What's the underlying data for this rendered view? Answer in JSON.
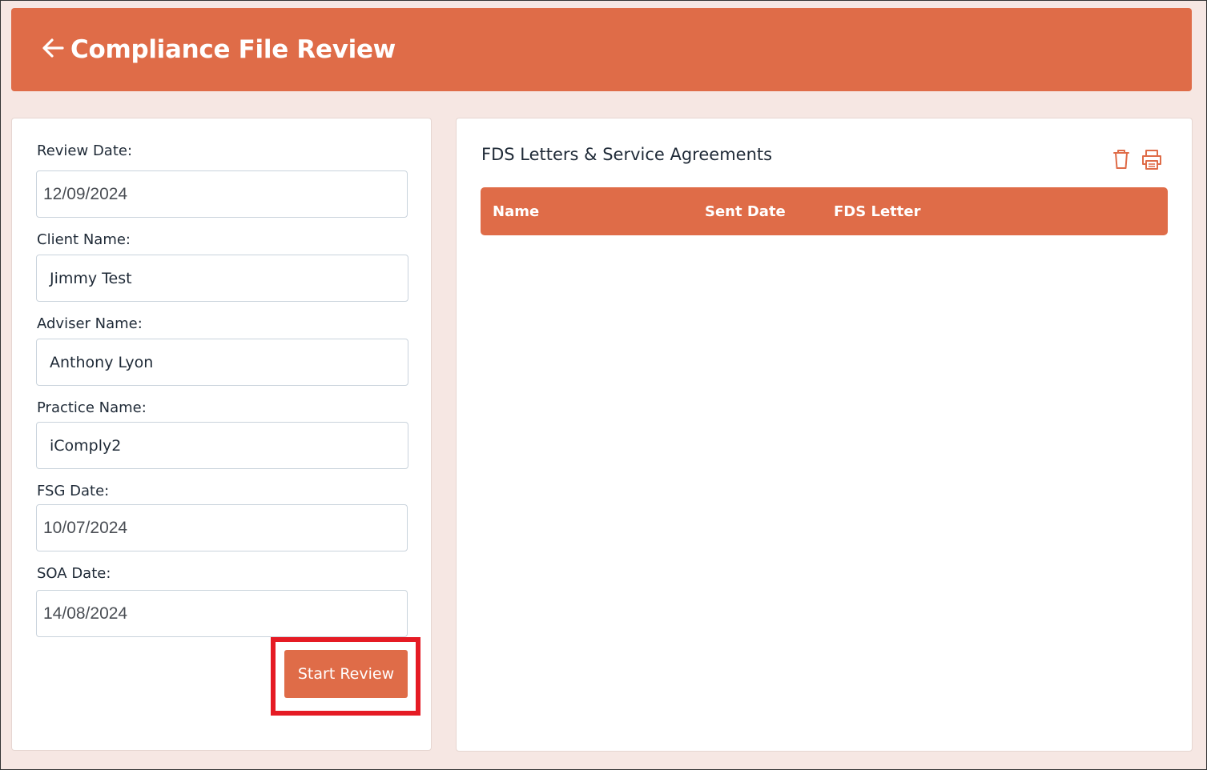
{
  "header": {
    "title": "Compliance File Review",
    "back_icon": "arrow-left-icon",
    "color": "#df6c48"
  },
  "form": {
    "review_date": {
      "label": "Review Date:",
      "value": "12/09/2024"
    },
    "client_name": {
      "label": "Client Name:",
      "value": "Jimmy Test"
    },
    "adviser_name": {
      "label": "Adviser Name:",
      "value": "Anthony Lyon"
    },
    "practice_name": {
      "label": "Practice Name:",
      "value": "iComply2"
    },
    "fsg_date": {
      "label": "FSG Date:",
      "value": "10/07/2024"
    },
    "soa_date": {
      "label": "SOA Date:",
      "value": "14/08/2024"
    },
    "start_button_label": "Start Review",
    "highlight_color": "#e51b24"
  },
  "fds_section": {
    "title": "FDS Letters & Service Agreements",
    "icons": [
      "trash-icon",
      "printer-icon"
    ],
    "columns": [
      "Name",
      "Sent Date",
      "FDS Letter"
    ],
    "rows": []
  }
}
